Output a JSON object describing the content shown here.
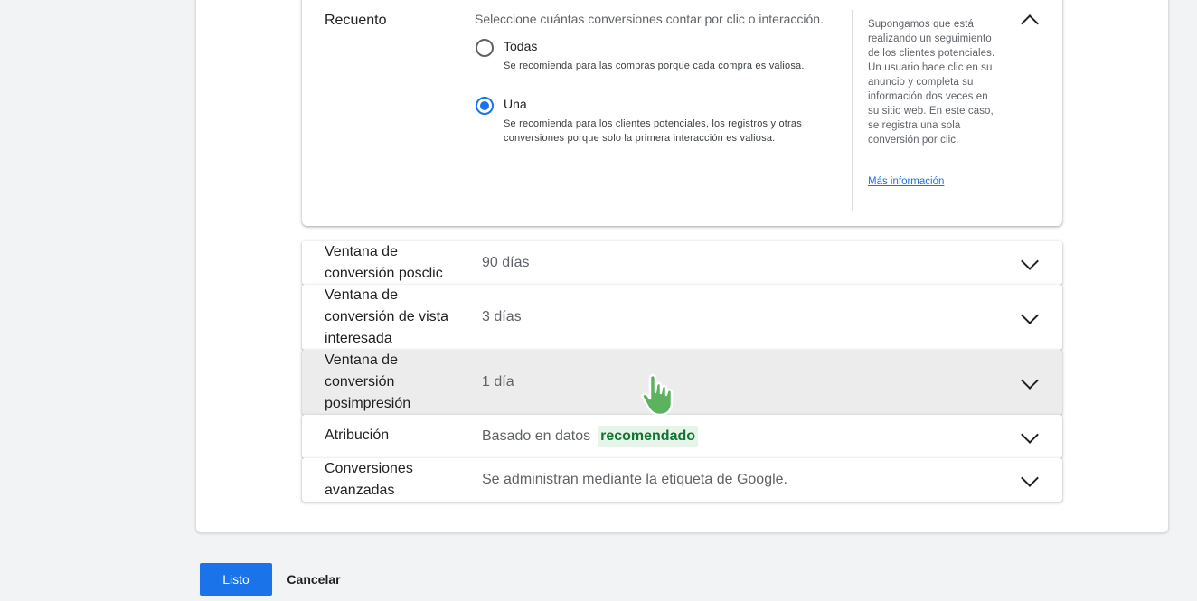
{
  "count": {
    "title": "Recuento",
    "description": "Seleccione cuántas conversiones contar por clic o interacción.",
    "options": [
      {
        "label": "Todas",
        "help": "Se recomienda para las compras porque cada compra es valiosa.",
        "selected": false
      },
      {
        "label": "Una",
        "help": "Se recomienda para los clientes potenciales, los registros y otras conversiones porque solo la primera interacción es valiosa.",
        "selected": true
      }
    ],
    "help_text": "Supongamos que está realizando un seguimiento de los clientes potenciales. Un usuario hace clic en su anuncio y completa su información dos veces en su sitio web. En este caso, se registra una sola conversión por clic.",
    "help_link": "Más información"
  },
  "settings": [
    {
      "label": "Ventana de conversión posclic",
      "value": "90 días"
    },
    {
      "label": "Ventana de conversión de vista interesada",
      "value": "3 días"
    },
    {
      "label": "Ventana de conversión posimpresión",
      "value": "1 día"
    },
    {
      "label": "Atribución",
      "value": "Basado en datos",
      "badge": "recomendado"
    },
    {
      "label": "Conversiones avanzadas",
      "value": "Se administran mediante la etiqueta de Google."
    }
  ],
  "actions": {
    "done": "Listo",
    "cancel": "Cancelar"
  },
  "colors": {
    "accent": "#1a73e8",
    "badge_bg": "#e6f4ea",
    "badge_text": "#137333",
    "cursor": "#4caf50"
  },
  "icons": {
    "collapse": "chevron-up-icon",
    "expand": "chevron-down-icon",
    "cursor": "hand-pointer-icon"
  }
}
